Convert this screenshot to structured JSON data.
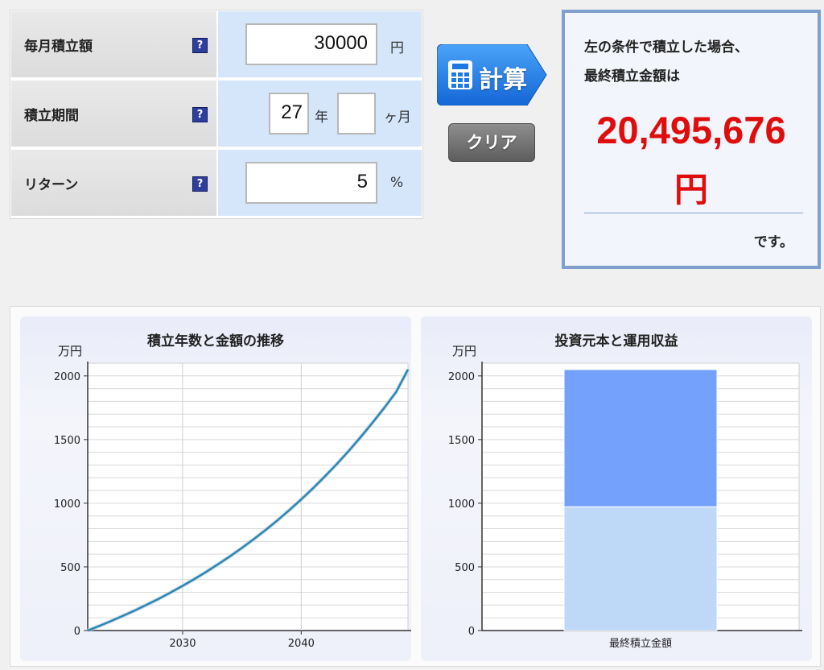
{
  "form": {
    "monthly": {
      "label": "毎月積立額",
      "value": "30000",
      "unit": "円"
    },
    "period": {
      "label": "積立期間",
      "years": "27",
      "years_unit": "年",
      "months": "",
      "months_unit": "ヶ月"
    },
    "return": {
      "label": "リターン",
      "value": "5",
      "unit": "%"
    },
    "help_glyph": "?",
    "help_icon_color": "#2d3e9c"
  },
  "buttons": {
    "calculate": "計算",
    "clear": "クリア",
    "calc_icon": "calculator-icon"
  },
  "result": {
    "line1": "左の条件で積立した場合、",
    "line2": "最終積立金額は",
    "amount": "20,495,676",
    "currency": "円",
    "suffix": "です。",
    "accent": "#e00d0d"
  },
  "chart_data": [
    {
      "type": "line",
      "title": "積立年数と金額の推移",
      "ylabel": "万円",
      "xlabel": "",
      "xlim": [
        2022,
        2049
      ],
      "ylim": [
        0,
        2100
      ],
      "x_ticks": [
        2030,
        2040
      ],
      "y_ticks": [
        0,
        500,
        1000,
        1500,
        2000
      ],
      "grid": true,
      "color": "#2a86b3",
      "series": [
        {
          "x": [
            2022,
            2023,
            2024,
            2025,
            2026,
            2027,
            2028,
            2029,
            2030,
            2031,
            2032,
            2033,
            2034,
            2035,
            2036,
            2037,
            2038,
            2039,
            2040,
            2041,
            2042,
            2043,
            2044,
            2045,
            2046,
            2047,
            2048,
            2049
          ],
          "y": [
            0,
            37,
            76,
            117,
            159,
            204,
            250,
            299,
            351,
            405,
            461,
            521,
            583,
            649,
            718,
            790,
            866,
            946,
            1030,
            1118,
            1211,
            1308,
            1410,
            1518,
            1631,
            1749,
            1874,
            2050
          ]
        }
      ]
    },
    {
      "type": "bar",
      "title": "投資元本と運用収益",
      "ylabel": "万円",
      "categories": [
        "最終積立金額"
      ],
      "ylim": [
        0,
        2100
      ],
      "y_ticks": [
        0,
        500,
        1000,
        1500,
        2000
      ],
      "stacked": true,
      "grid": true,
      "series": [
        {
          "values": [
            972
          ],
          "color": "#bed8f7"
        },
        {
          "values": [
            1078
          ],
          "color": "#74a1fb"
        }
      ]
    }
  ]
}
